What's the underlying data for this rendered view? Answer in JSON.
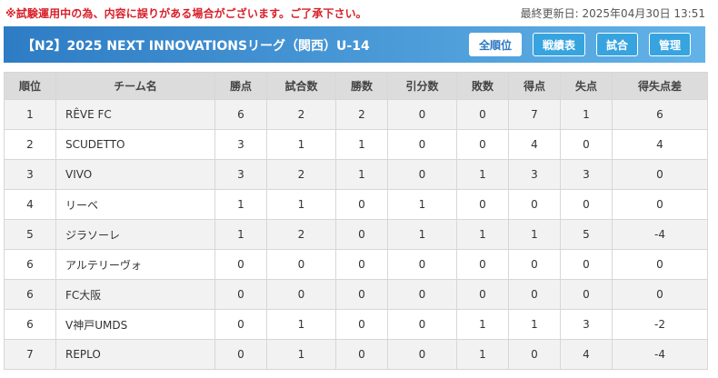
{
  "notice": "※試験運用中の為、内容に誤りがある場合がございます。ご了承下さい。",
  "last_updated": "最終更新日: 2025年04月30日 13:51",
  "league_title": "【N2】2025 NEXT INNOVATIONSリーグ（関西）U-14",
  "nav": {
    "standings": "全順位",
    "results": "戦績表",
    "matches": "試合",
    "admin": "管理"
  },
  "table": {
    "columns": [
      "順位",
      "チーム名",
      "勝点",
      "試合数",
      "勝数",
      "引分数",
      "敗数",
      "得点",
      "失点",
      "得失点差"
    ],
    "rows": [
      {
        "rank": "1",
        "team": "RÊVE FC",
        "points": "6",
        "played": "2",
        "wins": "2",
        "draws": "0",
        "losses": "0",
        "gf": "7",
        "ga": "1",
        "gd": "6"
      },
      {
        "rank": "2",
        "team": "SCUDETTO",
        "points": "3",
        "played": "1",
        "wins": "1",
        "draws": "0",
        "losses": "0",
        "gf": "4",
        "ga": "0",
        "gd": "4"
      },
      {
        "rank": "3",
        "team": "VIVO",
        "points": "3",
        "played": "2",
        "wins": "1",
        "draws": "0",
        "losses": "1",
        "gf": "3",
        "ga": "3",
        "gd": "0"
      },
      {
        "rank": "4",
        "team": "リーベ",
        "points": "1",
        "played": "1",
        "wins": "0",
        "draws": "1",
        "losses": "0",
        "gf": "0",
        "ga": "0",
        "gd": "0"
      },
      {
        "rank": "5",
        "team": "ジラソーレ",
        "points": "1",
        "played": "2",
        "wins": "0",
        "draws": "1",
        "losses": "1",
        "gf": "1",
        "ga": "5",
        "gd": "-4"
      },
      {
        "rank": "6",
        "team": "アルテリーヴォ",
        "points": "0",
        "played": "0",
        "wins": "0",
        "draws": "0",
        "losses": "0",
        "gf": "0",
        "ga": "0",
        "gd": "0"
      },
      {
        "rank": "6",
        "team": "FC大阪",
        "points": "0",
        "played": "0",
        "wins": "0",
        "draws": "0",
        "losses": "0",
        "gf": "0",
        "ga": "0",
        "gd": "0"
      },
      {
        "rank": "6",
        "team": "V神戸UMDS",
        "points": "0",
        "played": "1",
        "wins": "0",
        "draws": "0",
        "losses": "1",
        "gf": "1",
        "ga": "3",
        "gd": "-2"
      },
      {
        "rank": "7",
        "team": "REPLO",
        "points": "0",
        "played": "1",
        "wins": "0",
        "draws": "0",
        "losses": "1",
        "gf": "0",
        "ga": "4",
        "gd": "-4"
      }
    ]
  },
  "colors": {
    "notice": "#d8202a",
    "header_gradient_start": "#2e7cc4",
    "header_gradient_end": "#62b3e8",
    "button_fill": "#37a4e0"
  }
}
